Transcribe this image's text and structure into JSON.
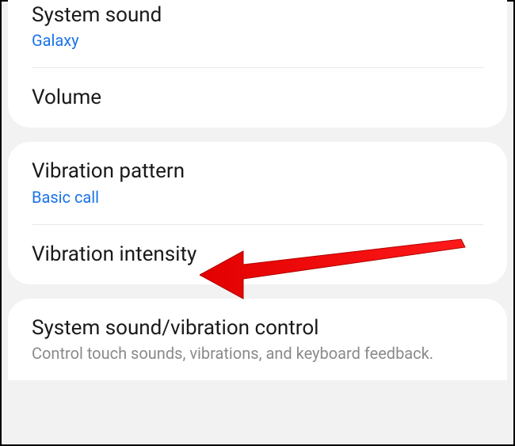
{
  "card1": {
    "system_sound": {
      "title": "System sound",
      "value": "Galaxy"
    },
    "volume": {
      "title": "Volume"
    }
  },
  "card2": {
    "vibration_pattern": {
      "title": "Vibration pattern",
      "value": "Basic call"
    },
    "vibration_intensity": {
      "title": "Vibration intensity"
    }
  },
  "card3": {
    "system_sound_vibration_control": {
      "title": "System sound/vibration control",
      "subtitle": "Control touch sounds, vibrations, and keyboard feedback."
    }
  }
}
